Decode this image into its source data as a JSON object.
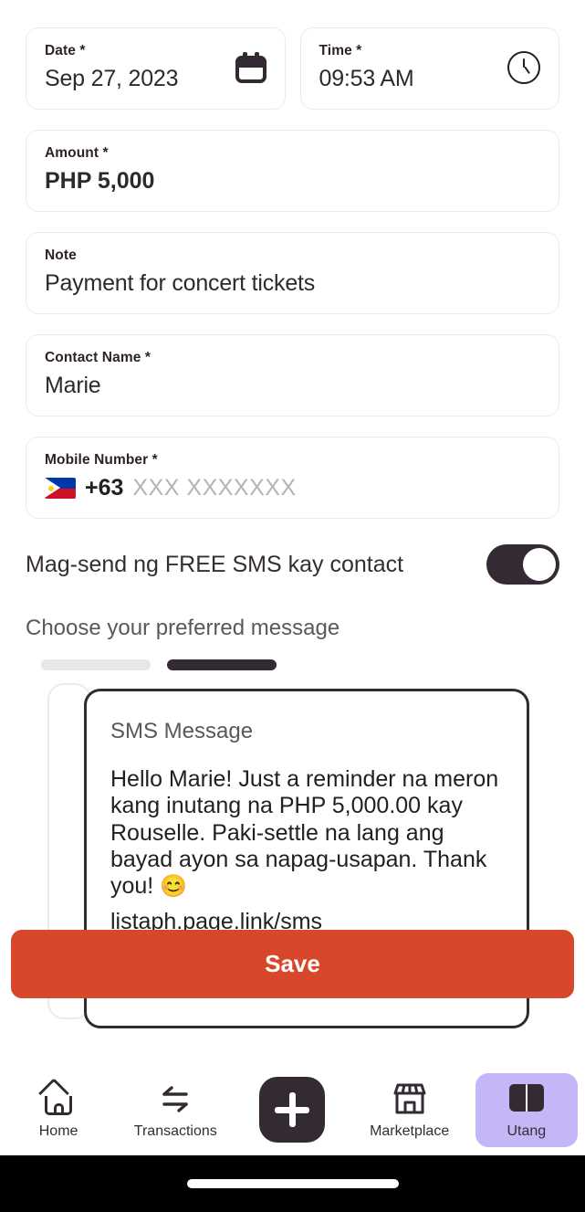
{
  "form": {
    "date": {
      "label": "Date *",
      "value": "Sep 27, 2023",
      "icon": "calendar-icon"
    },
    "time": {
      "label": "Time *",
      "value": "09:53 AM",
      "icon": "clock-icon"
    },
    "amount": {
      "label": "Amount *",
      "value": "PHP 5,000"
    },
    "note": {
      "label": "Note",
      "value": "Payment for concert tickets"
    },
    "contact_name": {
      "label": "Contact Name *",
      "value": "Marie"
    },
    "mobile_number": {
      "label": "Mobile Number *",
      "country_code": "+63",
      "placeholder": "XXX XXXXXXX",
      "flag": "philippines-flag-icon"
    }
  },
  "sms_toggle": {
    "label": "Mag-send ng FREE SMS kay contact",
    "state": "on"
  },
  "carousel": {
    "heading": "Choose your preferred message",
    "indicators": [
      {
        "state": "inactive"
      },
      {
        "state": "active"
      }
    ],
    "active_card": {
      "title": "SMS Message",
      "body": "Hello Marie! Just a reminder na meron kang inutang na PHP 5,000.00 kay Rouselle. Paki-settle na lang ang bayad ayon sa napag-usapan. Thank you!",
      "emoji": "😊",
      "link": "listaph.page.link/sms"
    }
  },
  "actions": {
    "save_label": "Save",
    "save_color": "#D9472A"
  },
  "bottom_nav": {
    "items": [
      {
        "label": "Home",
        "icon": "home-icon",
        "active": false
      },
      {
        "label": "Transactions",
        "icon": "transactions-swap-icon",
        "active": false
      },
      {
        "label": "",
        "icon": "plus-icon",
        "active": false
      },
      {
        "label": "Marketplace",
        "icon": "storefront-icon",
        "active": false
      },
      {
        "label": "Utang",
        "icon": "book-icon",
        "active": true
      }
    ],
    "active_color": "#C5B6F7"
  }
}
